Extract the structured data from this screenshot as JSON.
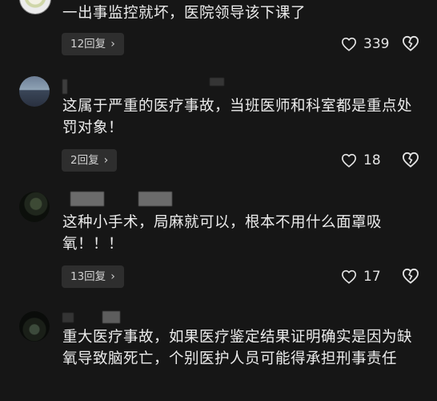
{
  "comments": [
    {
      "text": "一出事监控就坏，医院领导该下课了",
      "reply_label": "12回复",
      "likes": "339"
    },
    {
      "text": "这属于严重的医疗事故，当班医师和科室都是重点处罚对象！",
      "reply_label": "2回复",
      "likes": "18"
    },
    {
      "text": "这种小手术，局麻就可以，根本不用什么面罩吸氧！！！",
      "reply_label": "13回复",
      "likes": "17"
    },
    {
      "text": "重大医疗事故，如果医疗鉴定结果证明确实是因为缺氧导致脑死亡，个别医护人员可能得承担刑事责任",
      "reply_label": "",
      "likes": ""
    }
  ],
  "icons": {
    "like": "heart-outline-icon",
    "dislike": "broken-heart-icon",
    "reply_arrow": "chevron-right-icon"
  },
  "colors": {
    "background": "#161616",
    "text": "#ececec",
    "button_bg": "#2e2e2e"
  }
}
